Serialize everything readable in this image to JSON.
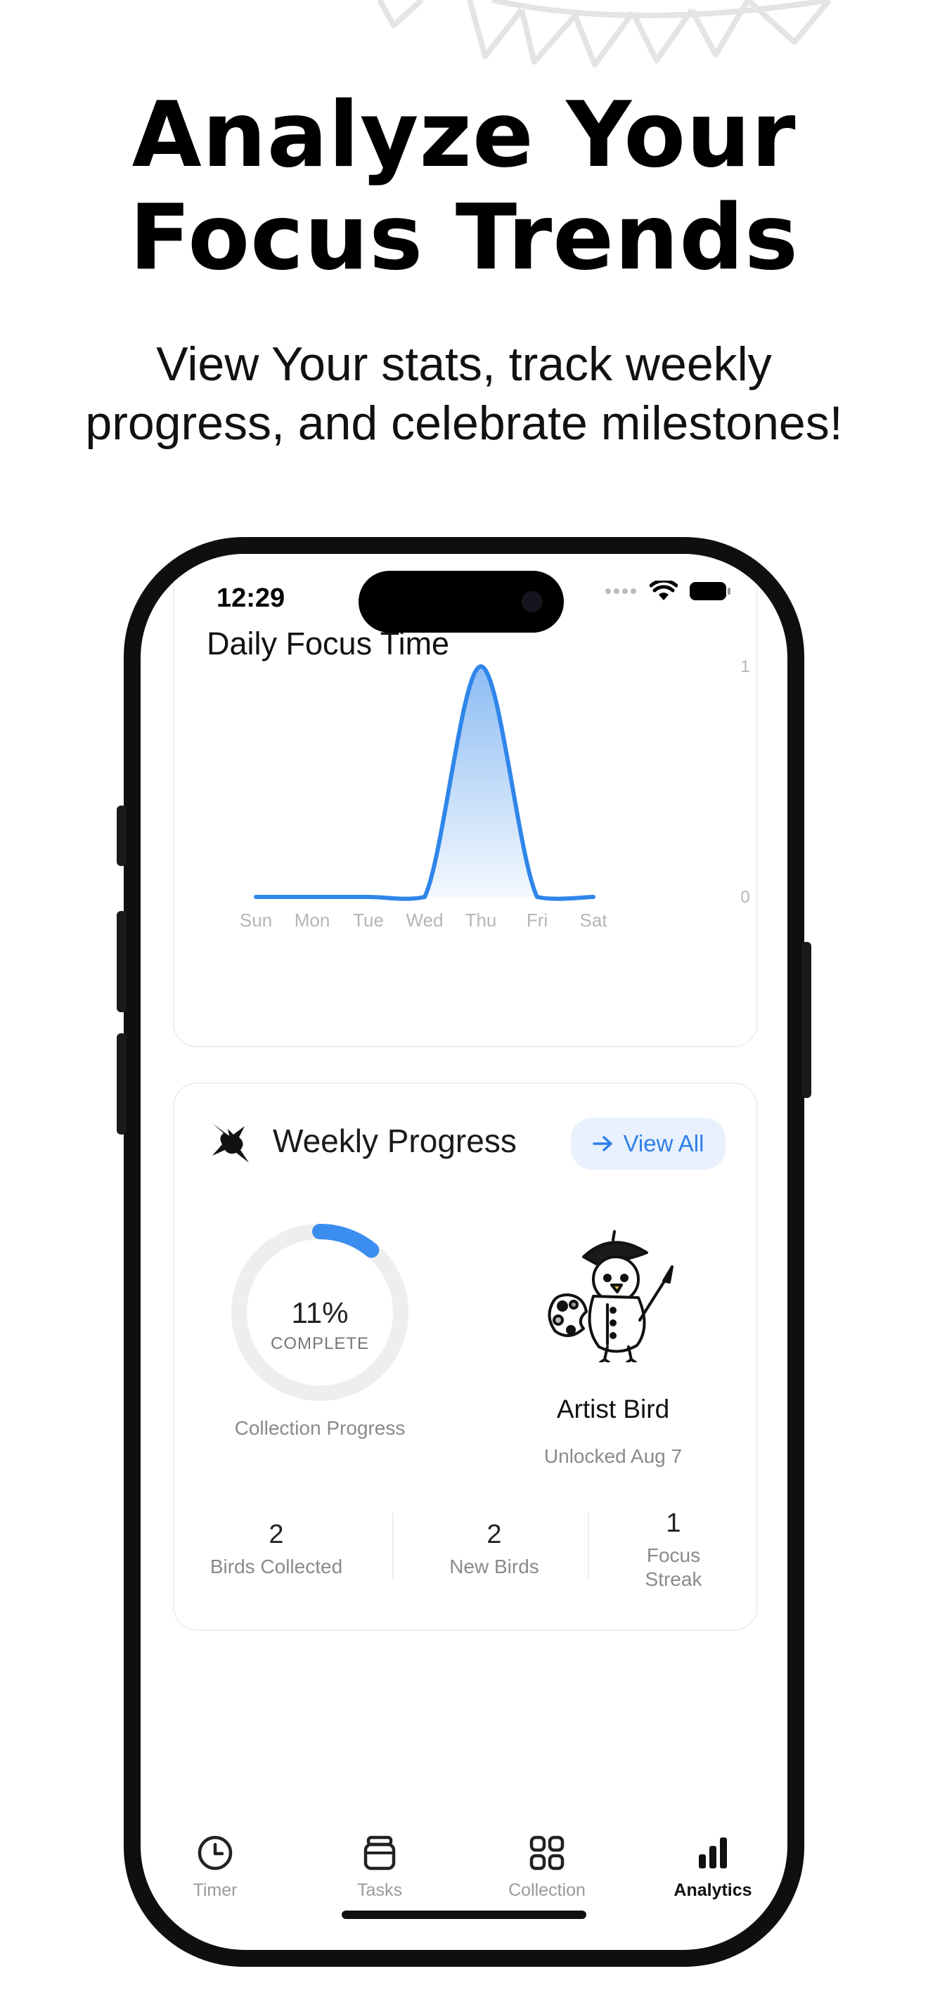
{
  "headline": {
    "line1": "Analyze Your",
    "line2": "Focus Trends"
  },
  "subheadline": {
    "line1": "View Your stats, track weekly",
    "line2": "progress, and celebrate milestones!"
  },
  "status_bar": {
    "time": "12:29"
  },
  "daily_focus": {
    "title": "Daily Focus Time",
    "chart_data": {
      "type": "area",
      "x": [
        "Sun",
        "Mon",
        "Tue",
        "Wed",
        "Thu",
        "Fri",
        "Sat"
      ],
      "y": [
        0,
        0,
        0,
        0,
        1,
        0,
        0
      ],
      "yticks": [
        "1",
        "0"
      ],
      "ylim": [
        0,
        1
      ],
      "color": "#2f86ea"
    }
  },
  "weekly_progress": {
    "title": "Weekly Progress",
    "view_all_label": "View All",
    "progress_percent_label": "11%",
    "progress_fraction": 0.11,
    "complete_label": "COMPLETE",
    "progress_caption": "Collection Progress",
    "bird_name": "Artist Bird",
    "bird_unlocked": "Unlocked Aug 7",
    "stats": [
      {
        "value": "2",
        "label": "Birds Collected"
      },
      {
        "value": "2",
        "label": "New Birds"
      },
      {
        "value": "1",
        "label_line1": "Focus",
        "label_line2": "Streak"
      }
    ]
  },
  "tabbar": {
    "tabs": [
      {
        "label": "Timer",
        "icon": "clock-icon"
      },
      {
        "label": "Tasks",
        "icon": "jar-icon"
      },
      {
        "label": "Collection",
        "icon": "grid-icon"
      },
      {
        "label": "Analytics",
        "icon": "bar-chart-icon",
        "active": true
      }
    ]
  },
  "colors": {
    "accent": "#2f86ea",
    "accent_light": "#e8f1fd"
  }
}
